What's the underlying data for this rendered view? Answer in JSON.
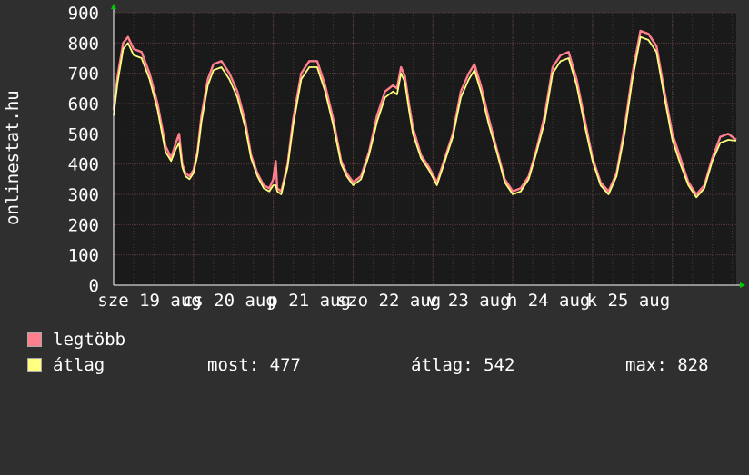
{
  "site_label": "onlinestat.hu",
  "colors": {
    "background": "#2f2f2f",
    "plot_background": "#1a1a1a",
    "grid": "#5a3a3a",
    "max_series": "#ff7f8f",
    "avg_series": "#ffff7f",
    "axis_arrow": "#00cc00"
  },
  "chart_data": {
    "type": "line",
    "ylim": [
      0,
      900
    ],
    "yticks": [
      "0",
      "100",
      "200",
      "300",
      "400",
      "500",
      "600",
      "700",
      "800",
      "900"
    ],
    "xlim": [
      0,
      7.8
    ],
    "xticks": [
      {
        "pos": 0.45,
        "label": "sze 19 aug"
      },
      {
        "pos": 1.45,
        "label": "cs 20 aug"
      },
      {
        "pos": 2.45,
        "label": "p 21 aug"
      },
      {
        "pos": 3.45,
        "label": "szo 22 aug"
      },
      {
        "pos": 4.45,
        "label": "v 23 aug"
      },
      {
        "pos": 5.45,
        "label": "h 24 aug"
      },
      {
        "pos": 6.45,
        "label": "k 25 aug"
      }
    ],
    "series": [
      {
        "name": "legtöbb",
        "x": [
          0,
          0.05,
          0.12,
          0.18,
          0.25,
          0.35,
          0.45,
          0.55,
          0.65,
          0.72,
          0.78,
          0.82,
          0.86,
          0.9,
          0.95,
          1.0,
          1.05,
          1.1,
          1.18,
          1.25,
          1.35,
          1.45,
          1.55,
          1.65,
          1.72,
          1.8,
          1.88,
          1.95,
          2.0,
          2.03,
          2.05,
          2.1,
          2.18,
          2.25,
          2.35,
          2.45,
          2.55,
          2.65,
          2.75,
          2.85,
          2.92,
          3.0,
          3.1,
          3.2,
          3.3,
          3.4,
          3.5,
          3.55,
          3.6,
          3.65,
          3.7,
          3.75,
          3.85,
          3.95,
          4.05,
          4.15,
          4.25,
          4.35,
          4.45,
          4.52,
          4.6,
          4.7,
          4.8,
          4.9,
          5.0,
          5.1,
          5.2,
          5.3,
          5.4,
          5.5,
          5.6,
          5.7,
          5.8,
          5.9,
          6.0,
          6.1,
          6.2,
          6.3,
          6.4,
          6.5,
          6.6,
          6.7,
          6.8,
          6.9,
          7.0,
          7.1,
          7.2,
          7.3,
          7.4,
          7.5,
          7.6,
          7.7,
          7.8
        ],
        "values": [
          580,
          690,
          800,
          820,
          780,
          770,
          700,
          600,
          460,
          420,
          470,
          500,
          400,
          370,
          360,
          380,
          440,
          560,
          680,
          730,
          740,
          700,
          640,
          540,
          430,
          370,
          330,
          320,
          350,
          410,
          320,
          310,
          400,
          550,
          700,
          740,
          740,
          660,
          550,
          410,
          370,
          340,
          360,
          440,
          560,
          640,
          660,
          650,
          720,
          690,
          600,
          520,
          430,
          390,
          340,
          420,
          500,
          640,
          700,
          730,
          660,
          550,
          450,
          350,
          310,
          320,
          360,
          450,
          560,
          720,
          760,
          770,
          680,
          550,
          420,
          340,
          310,
          370,
          520,
          700,
          840,
          830,
          790,
          640,
          500,
          420,
          340,
          300,
          330,
          420,
          490,
          500,
          480
        ],
        "color_key": "max_series"
      },
      {
        "name": "átlag",
        "x": [
          0,
          0.05,
          0.12,
          0.18,
          0.25,
          0.35,
          0.45,
          0.55,
          0.65,
          0.72,
          0.78,
          0.82,
          0.86,
          0.9,
          0.95,
          1.0,
          1.05,
          1.1,
          1.18,
          1.25,
          1.35,
          1.45,
          1.55,
          1.65,
          1.72,
          1.8,
          1.88,
          1.95,
          2.0,
          2.03,
          2.05,
          2.1,
          2.18,
          2.25,
          2.35,
          2.45,
          2.55,
          2.65,
          2.75,
          2.85,
          2.92,
          3.0,
          3.1,
          3.2,
          3.3,
          3.4,
          3.5,
          3.55,
          3.6,
          3.65,
          3.7,
          3.75,
          3.85,
          3.95,
          4.05,
          4.15,
          4.25,
          4.35,
          4.45,
          4.52,
          4.6,
          4.7,
          4.8,
          4.9,
          5.0,
          5.1,
          5.2,
          5.3,
          5.4,
          5.5,
          5.6,
          5.7,
          5.8,
          5.9,
          6.0,
          6.1,
          6.2,
          6.3,
          6.4,
          6.5,
          6.6,
          6.7,
          6.8,
          6.9,
          7.0,
          7.1,
          7.2,
          7.3,
          7.4,
          7.5,
          7.6,
          7.7,
          7.8
        ],
        "values": [
          560,
          670,
          780,
          800,
          760,
          750,
          680,
          580,
          440,
          410,
          450,
          470,
          390,
          360,
          350,
          370,
          430,
          540,
          660,
          710,
          720,
          680,
          620,
          520,
          420,
          360,
          320,
          310,
          330,
          330,
          310,
          300,
          390,
          530,
          680,
          720,
          720,
          640,
          530,
          400,
          360,
          330,
          350,
          430,
          540,
          620,
          640,
          630,
          700,
          670,
          580,
          500,
          420,
          380,
          330,
          410,
          490,
          620,
          680,
          710,
          640,
          530,
          440,
          340,
          300,
          310,
          350,
          440,
          540,
          700,
          740,
          750,
          660,
          530,
          410,
          330,
          300,
          360,
          500,
          680,
          820,
          810,
          770,
          620,
          480,
          400,
          330,
          290,
          320,
          410,
          470,
          480,
          477
        ],
        "color_key": "avg_series"
      }
    ]
  },
  "legend": {
    "items": [
      {
        "label": "legtöbb",
        "color": "#ff7f8f"
      },
      {
        "label": "átlag",
        "color": "#ffff7f"
      }
    ],
    "stats": {
      "most": "most: 477",
      "atlag": "átlag: 542",
      "max": "max: 828"
    }
  }
}
